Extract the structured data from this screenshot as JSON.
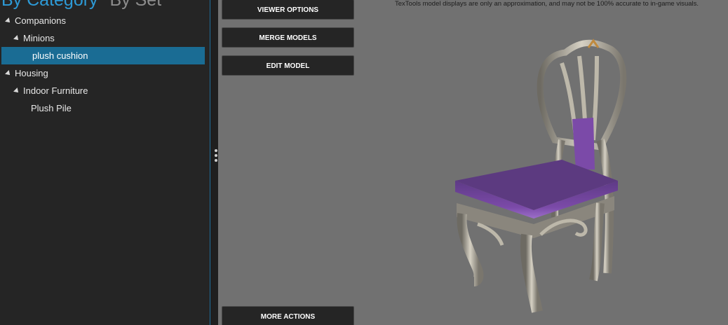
{
  "tabs": {
    "active": "By Category",
    "inactive": "By Set"
  },
  "tree": {
    "companions": "Companions",
    "minions": "Minions",
    "plush_cushion": "plush cushion",
    "housing": "Housing",
    "indoor_furniture": "Indoor Furniture",
    "plush_pile": "Plush Pile"
  },
  "viewer": {
    "disclaimer": "TexTools model displays are only an approximation, and may not be 100% accurate to in-game visuals.",
    "viewer_options": "VIEWER OPTIONS",
    "merge_models": "MERGE MODELS",
    "edit_model": "EDIT MODEL",
    "more_actions": "MORE ACTIONS"
  },
  "colors": {
    "accent": "#1a6c94",
    "tab_active": "#2d9ad6",
    "viewport_bg": "#717171",
    "cushion": "#7b4aa8"
  }
}
